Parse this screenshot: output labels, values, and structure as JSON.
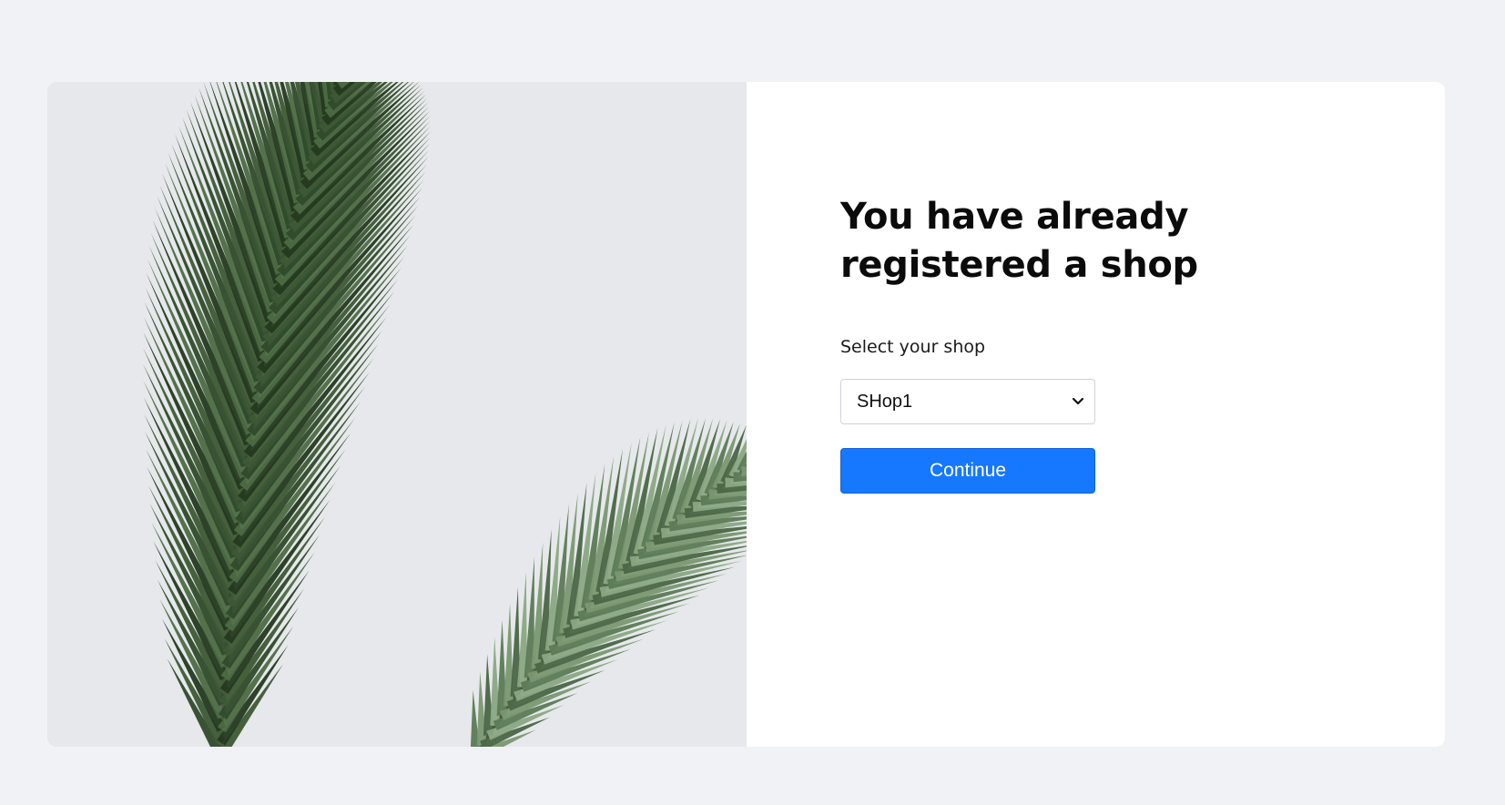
{
  "page": {
    "background": "#f0f2f5",
    "accent": "#1677ff"
  },
  "hero_image": {
    "icon": "palm-leaf-image"
  },
  "main": {
    "title": "You have already registered a shop",
    "select_label": "Select your shop",
    "select_value": "SHop1",
    "continue_label": "Continue"
  }
}
